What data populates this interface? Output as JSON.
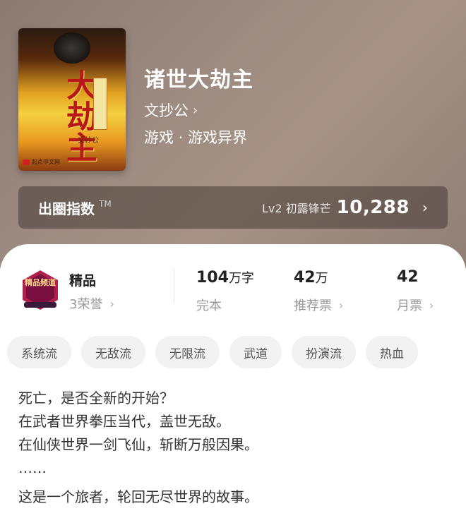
{
  "book": {
    "cover": {
      "title": "大劫主",
      "side_badge": "轮回",
      "author": "文抄公",
      "publisher": "起点中文网"
    },
    "title": "诸世大劫主",
    "author": "文抄公",
    "genre": "游戏 · 游戏异界"
  },
  "index": {
    "label": "出圈指数",
    "tm": "TM",
    "level": "Lv2 初露锋芒",
    "value": "10,288"
  },
  "honor": {
    "badge_text": "精品频道",
    "label": "精品",
    "count": "3荣誉"
  },
  "stats": [
    {
      "number": "104",
      "unit": "万字",
      "label": "完本",
      "has_chevron": false
    },
    {
      "number": "42",
      "unit": "万",
      "label": "推荐票",
      "has_chevron": true
    },
    {
      "number": "42",
      "unit": "",
      "label": "月票",
      "has_chevron": true
    }
  ],
  "tags": [
    "系统流",
    "无敌流",
    "无限流",
    "武道",
    "扮演流",
    "热血"
  ],
  "description": [
    "死亡，是否全新的开始？",
    "在武者世界拳压当代，盖世无敌。",
    "在仙侠世界一剑飞仙，斩断万般因果。",
    "……",
    "这是一个旅者，轮回无尽世界的故事。"
  ],
  "colors": {
    "hero_bg": "#9c8a80",
    "badge_bg": "#b0204a",
    "text_primary": "#222222",
    "text_secondary": "#999999",
    "tag_bg": "#f2f2f2"
  },
  "icons": {
    "chevron": "chevron-right-icon",
    "badge": "quality-badge-icon"
  }
}
